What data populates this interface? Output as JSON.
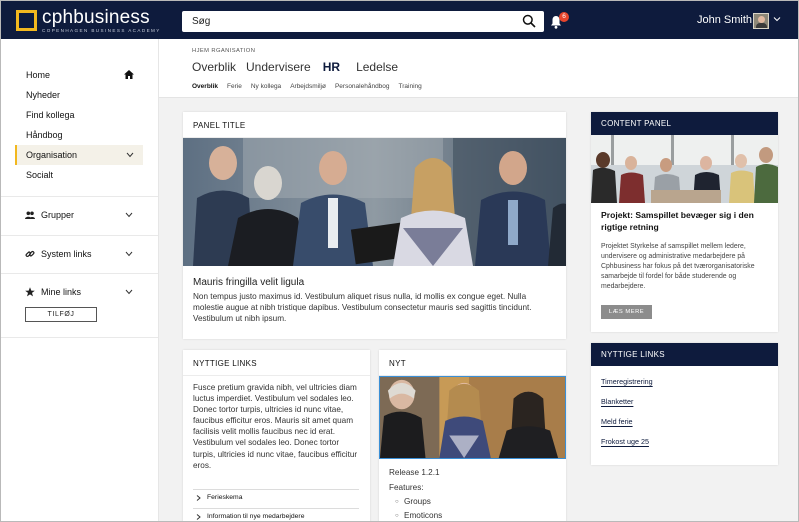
{
  "brand": {
    "logo_text": "cphbusiness",
    "logo_sub": "COPENHAGEN BUSINESS ACADEMY",
    "accent": "#f2b81f",
    "navy": "#0e1b3d"
  },
  "header": {
    "search_placeholder": "Søg",
    "notification_count": "6",
    "user_name": "John Smith"
  },
  "sidebar": {
    "items": [
      {
        "label": "Home"
      },
      {
        "label": "Nyheder"
      },
      {
        "label": "Find kollega"
      },
      {
        "label": "Håndbog"
      },
      {
        "label": "Organisation"
      },
      {
        "label": "Socialt"
      }
    ],
    "groups": [
      {
        "label": "Grupper",
        "icon": "people-icon"
      },
      {
        "label": "System links",
        "icon": "link-icon"
      },
      {
        "label": "Mine links",
        "icon": "star-icon"
      }
    ],
    "add_button": "TILFØJ"
  },
  "page": {
    "breadcrumb": "HJEM RGANISATION",
    "tabs": [
      "Overblik",
      "Undervisere",
      "HR",
      "Ledelse"
    ],
    "subtabs": [
      "Overblik",
      "Ferie",
      "Ny kollega",
      "Arbejdsmiljø",
      "Personalehåndbog",
      "Training"
    ]
  },
  "panel": {
    "title": "PANEL TITLE",
    "heading": "Mauris fringilla velit ligula",
    "body": "Non tempus justo maximus id. Vestibulum aliquet risus nulla, id mollis ex congue eget. Nulla molestie augue at nibh tristique dapibus. Vestibulum consectetur mauris sed sagittis tincidunt. Vestibulum ut nibh ipsum."
  },
  "content_panel": {
    "title": "CONTENT PANEL",
    "heading": "Projekt: Samspillet bevæger sig i den rigtige retning",
    "body": "Projektet Styrkelse af samspillet mellem ledere, undervisere og administrative medarbejdere på Cphbusiness har fokus på det tværorganisatoriske samarbejde til fordel for både studerende og medarbejdere.",
    "button": "LÆS MERE"
  },
  "useful_links_left": {
    "title": "NYTTIGE LINKS",
    "body": "Fusce pretium gravida nibh, vel ultricies diam luctus imperdiet. Vestibulum vel sodales leo. Donec tortor turpis, ultricies id nunc vitae, faucibus efficitur eros. Mauris sit amet quam facilisis velit mollis faucibus nec id erat. Vestibulum vel sodales leo. Donec tortor turpis, ultricies id nunc vitae, faucibus efficitur eros.",
    "items": [
      "Ferieskema",
      "Information til nye medarbejdere"
    ]
  },
  "news": {
    "title": "NYT",
    "release": "Release 1.2.1",
    "features_label": "Features:",
    "features": [
      "Groups",
      "Emoticons"
    ]
  },
  "useful_links_right": {
    "title": "NYTTIGE LINKS",
    "links": [
      "Timeregistrering",
      "Blanketter",
      "Meld ferie",
      "Frokost uge 25"
    ]
  }
}
